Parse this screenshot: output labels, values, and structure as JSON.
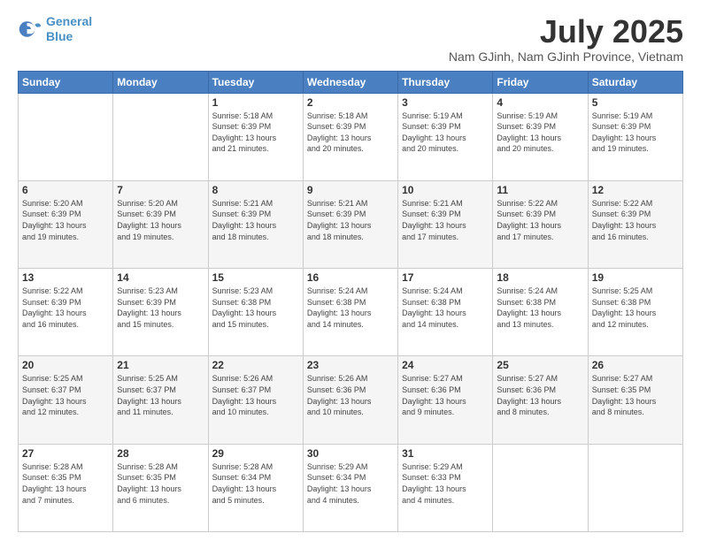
{
  "header": {
    "logo_line1": "General",
    "logo_line2": "Blue",
    "month": "July 2025",
    "location": "Nam GJinh, Nam GJinh Province, Vietnam"
  },
  "weekdays": [
    "Sunday",
    "Monday",
    "Tuesday",
    "Wednesday",
    "Thursday",
    "Friday",
    "Saturday"
  ],
  "weeks": [
    [
      {
        "day": "",
        "text": ""
      },
      {
        "day": "",
        "text": ""
      },
      {
        "day": "1",
        "text": "Sunrise: 5:18 AM\nSunset: 6:39 PM\nDaylight: 13 hours\nand 21 minutes."
      },
      {
        "day": "2",
        "text": "Sunrise: 5:18 AM\nSunset: 6:39 PM\nDaylight: 13 hours\nand 20 minutes."
      },
      {
        "day": "3",
        "text": "Sunrise: 5:19 AM\nSunset: 6:39 PM\nDaylight: 13 hours\nand 20 minutes."
      },
      {
        "day": "4",
        "text": "Sunrise: 5:19 AM\nSunset: 6:39 PM\nDaylight: 13 hours\nand 20 minutes."
      },
      {
        "day": "5",
        "text": "Sunrise: 5:19 AM\nSunset: 6:39 PM\nDaylight: 13 hours\nand 19 minutes."
      }
    ],
    [
      {
        "day": "6",
        "text": "Sunrise: 5:20 AM\nSunset: 6:39 PM\nDaylight: 13 hours\nand 19 minutes."
      },
      {
        "day": "7",
        "text": "Sunrise: 5:20 AM\nSunset: 6:39 PM\nDaylight: 13 hours\nand 19 minutes."
      },
      {
        "day": "8",
        "text": "Sunrise: 5:21 AM\nSunset: 6:39 PM\nDaylight: 13 hours\nand 18 minutes."
      },
      {
        "day": "9",
        "text": "Sunrise: 5:21 AM\nSunset: 6:39 PM\nDaylight: 13 hours\nand 18 minutes."
      },
      {
        "day": "10",
        "text": "Sunrise: 5:21 AM\nSunset: 6:39 PM\nDaylight: 13 hours\nand 17 minutes."
      },
      {
        "day": "11",
        "text": "Sunrise: 5:22 AM\nSunset: 6:39 PM\nDaylight: 13 hours\nand 17 minutes."
      },
      {
        "day": "12",
        "text": "Sunrise: 5:22 AM\nSunset: 6:39 PM\nDaylight: 13 hours\nand 16 minutes."
      }
    ],
    [
      {
        "day": "13",
        "text": "Sunrise: 5:22 AM\nSunset: 6:39 PM\nDaylight: 13 hours\nand 16 minutes."
      },
      {
        "day": "14",
        "text": "Sunrise: 5:23 AM\nSunset: 6:39 PM\nDaylight: 13 hours\nand 15 minutes."
      },
      {
        "day": "15",
        "text": "Sunrise: 5:23 AM\nSunset: 6:38 PM\nDaylight: 13 hours\nand 15 minutes."
      },
      {
        "day": "16",
        "text": "Sunrise: 5:24 AM\nSunset: 6:38 PM\nDaylight: 13 hours\nand 14 minutes."
      },
      {
        "day": "17",
        "text": "Sunrise: 5:24 AM\nSunset: 6:38 PM\nDaylight: 13 hours\nand 14 minutes."
      },
      {
        "day": "18",
        "text": "Sunrise: 5:24 AM\nSunset: 6:38 PM\nDaylight: 13 hours\nand 13 minutes."
      },
      {
        "day": "19",
        "text": "Sunrise: 5:25 AM\nSunset: 6:38 PM\nDaylight: 13 hours\nand 12 minutes."
      }
    ],
    [
      {
        "day": "20",
        "text": "Sunrise: 5:25 AM\nSunset: 6:37 PM\nDaylight: 13 hours\nand 12 minutes."
      },
      {
        "day": "21",
        "text": "Sunrise: 5:25 AM\nSunset: 6:37 PM\nDaylight: 13 hours\nand 11 minutes."
      },
      {
        "day": "22",
        "text": "Sunrise: 5:26 AM\nSunset: 6:37 PM\nDaylight: 13 hours\nand 10 minutes."
      },
      {
        "day": "23",
        "text": "Sunrise: 5:26 AM\nSunset: 6:36 PM\nDaylight: 13 hours\nand 10 minutes."
      },
      {
        "day": "24",
        "text": "Sunrise: 5:27 AM\nSunset: 6:36 PM\nDaylight: 13 hours\nand 9 minutes."
      },
      {
        "day": "25",
        "text": "Sunrise: 5:27 AM\nSunset: 6:36 PM\nDaylight: 13 hours\nand 8 minutes."
      },
      {
        "day": "26",
        "text": "Sunrise: 5:27 AM\nSunset: 6:35 PM\nDaylight: 13 hours\nand 8 minutes."
      }
    ],
    [
      {
        "day": "27",
        "text": "Sunrise: 5:28 AM\nSunset: 6:35 PM\nDaylight: 13 hours\nand 7 minutes."
      },
      {
        "day": "28",
        "text": "Sunrise: 5:28 AM\nSunset: 6:35 PM\nDaylight: 13 hours\nand 6 minutes."
      },
      {
        "day": "29",
        "text": "Sunrise: 5:28 AM\nSunset: 6:34 PM\nDaylight: 13 hours\nand 5 minutes."
      },
      {
        "day": "30",
        "text": "Sunrise: 5:29 AM\nSunset: 6:34 PM\nDaylight: 13 hours\nand 4 minutes."
      },
      {
        "day": "31",
        "text": "Sunrise: 5:29 AM\nSunset: 6:33 PM\nDaylight: 13 hours\nand 4 minutes."
      },
      {
        "day": "",
        "text": ""
      },
      {
        "day": "",
        "text": ""
      }
    ]
  ]
}
